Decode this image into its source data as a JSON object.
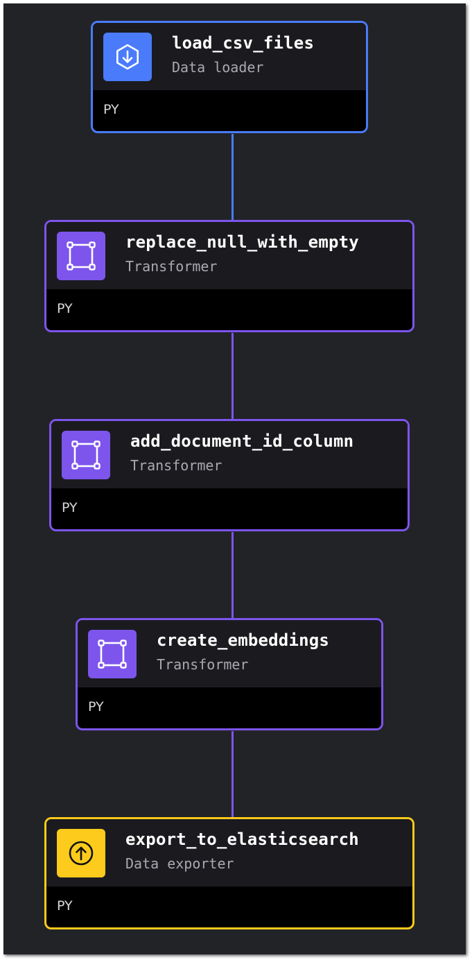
{
  "colors": {
    "loader": "#4a7bfa",
    "transformer": "#7d55ec",
    "exporter": "#fccb1b"
  },
  "blocks": [
    {
      "name": "load_csv_files",
      "type": "Data loader",
      "language": "PY",
      "icon": "download-icon"
    },
    {
      "name": "replace_null_with_empty",
      "type": "Transformer",
      "language": "PY",
      "icon": "transform-square-icon"
    },
    {
      "name": "add_document_id_column",
      "type": "Transformer",
      "language": "PY",
      "icon": "transform-square-icon"
    },
    {
      "name": "create_embeddings",
      "type": "Transformer",
      "language": "PY",
      "icon": "transform-square-icon"
    },
    {
      "name": "export_to_elasticsearch",
      "type": "Data exporter",
      "language": "PY",
      "icon": "upload-icon"
    }
  ]
}
